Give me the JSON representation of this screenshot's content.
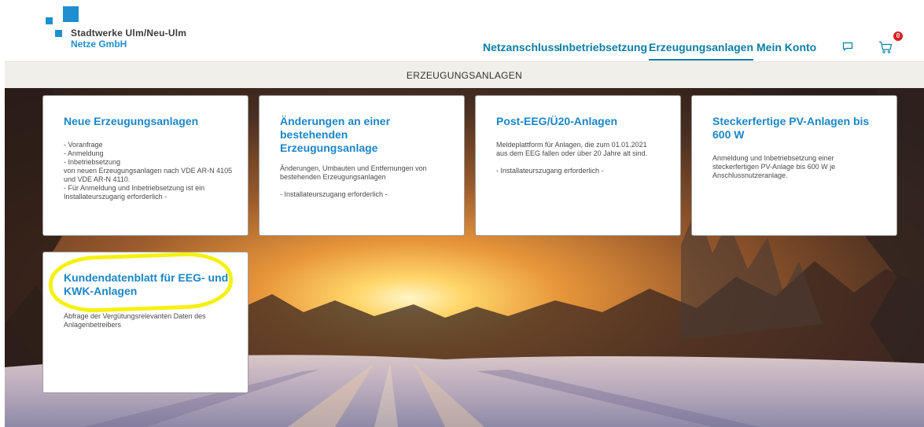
{
  "logo": {
    "company": "Stadtwerke Ulm/Neu-Ulm",
    "division": "Netze GmbH"
  },
  "nav": {
    "items": [
      {
        "label": "Netzanschluss",
        "active": false
      },
      {
        "label": "Inbetriebsetzung",
        "active": false
      },
      {
        "label": "Erzeugungsanlagen",
        "active": true
      },
      {
        "label": "Mein Konto",
        "active": false
      }
    ],
    "chat_icon": "chat-bubble-icon",
    "cart_icon": "cart-icon",
    "cart_badge": "0"
  },
  "subbar": {
    "title": "ERZEUGUNGSANLAGEN"
  },
  "cards": [
    {
      "title": "Neue Erzeugungsanlagen",
      "lines": [
        "- Voranfrage",
        "- Anmeldung",
        "- Inbetriebsetzung",
        "von neuen Erzeugungsanlagen nach VDE AR-N 4105",
        "und VDE AR-N 4110.",
        "- Für Anmeldung und Inbetriebsetzung ist ein",
        "Installateurszugang erforderlich -"
      ]
    },
    {
      "title": "Änderungen an einer bestehenden Erzeugungsanlage",
      "lines": [
        "Änderungen, Umbauten und Entfernungen von",
        "bestehenden Erzeugungsanlagen",
        "",
        "- Installateurszugang erforderlich -"
      ]
    },
    {
      "title": "Post-EEG/Ü20-Anlagen",
      "lines": [
        "Meldeplattform für Anlagen, die zum 01.01.2021",
        "aus dem EEG fallen oder über 20 Jahre alt sind.",
        "",
        "- Installateurszugang erforderlich -"
      ]
    },
    {
      "title": "Steckerfertige PV-Anlagen bis 600 W",
      "lines": [
        "Anmeldung und Inbetriebsetzung einer",
        "steckerfertigen PV-Anlage bis 600 W je",
        "Anschlussnutzeranlage."
      ]
    },
    {
      "title": "Kundendatenblatt für EEG- und KWK-Anlagen",
      "lines": [
        "Abfrage der Vergütungsrelevanten Daten des",
        "Anlagenbetreibers"
      ]
    }
  ],
  "colors": {
    "brand_blue": "#1e8fcf",
    "nav_teal": "#0b7ea6",
    "title_blue": "#1b86c6",
    "badge_red": "#d92020",
    "highlight_yellow": "#f5f110"
  }
}
